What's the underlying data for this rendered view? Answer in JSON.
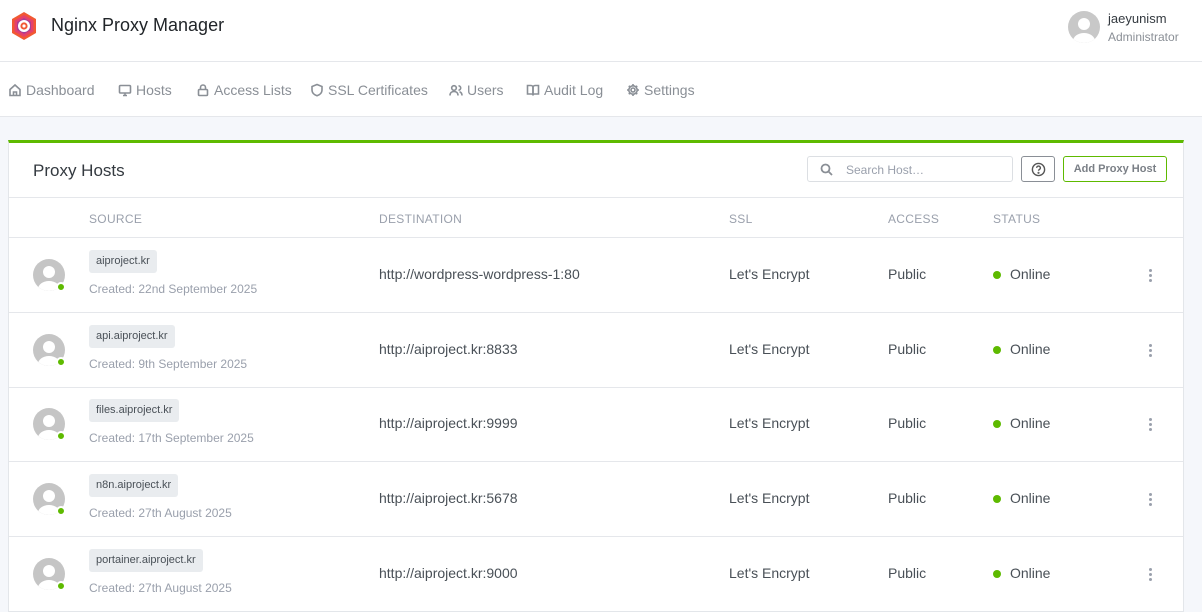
{
  "header": {
    "app_title": "Nginx Proxy Manager",
    "user": {
      "name": "jaeyunism",
      "role": "Administrator"
    }
  },
  "nav": [
    {
      "label": "Dashboard",
      "icon": "home-icon"
    },
    {
      "label": "Hosts",
      "icon": "monitor-icon"
    },
    {
      "label": "Access Lists",
      "icon": "lock-icon"
    },
    {
      "label": "SSL Certificates",
      "icon": "shield-icon"
    },
    {
      "label": "Users",
      "icon": "users-icon"
    },
    {
      "label": "Audit Log",
      "icon": "book-icon"
    },
    {
      "label": "Settings",
      "icon": "gear-icon"
    }
  ],
  "card": {
    "title": "Proxy Hosts",
    "search_placeholder": "Search Host…",
    "add_label": "Add Proxy Host",
    "accent_color": "#5eba00"
  },
  "columns": {
    "source": "SOURCE",
    "destination": "DESTINATION",
    "ssl": "SSL",
    "access": "ACCESS",
    "status": "STATUS"
  },
  "rows": [
    {
      "domain": "aiproject.kr",
      "created": "Created: 22nd September 2025",
      "destination": "http://wordpress-wordpress-1:80",
      "ssl": "Let's Encrypt",
      "access": "Public",
      "status": "Online"
    },
    {
      "domain": "api.aiproject.kr",
      "created": "Created: 9th September 2025",
      "destination": "http://aiproject.kr:8833",
      "ssl": "Let's Encrypt",
      "access": "Public",
      "status": "Online"
    },
    {
      "domain": "files.aiproject.kr",
      "created": "Created: 17th September 2025",
      "destination": "http://aiproject.kr:9999",
      "ssl": "Let's Encrypt",
      "access": "Public",
      "status": "Online"
    },
    {
      "domain": "n8n.aiproject.kr",
      "created": "Created: 27th August 2025",
      "destination": "http://aiproject.kr:5678",
      "ssl": "Let's Encrypt",
      "access": "Public",
      "status": "Online"
    },
    {
      "domain": "portainer.aiproject.kr",
      "created": "Created: 27th August 2025",
      "destination": "http://aiproject.kr:9000",
      "ssl": "Let's Encrypt",
      "access": "Public",
      "status": "Online"
    }
  ]
}
